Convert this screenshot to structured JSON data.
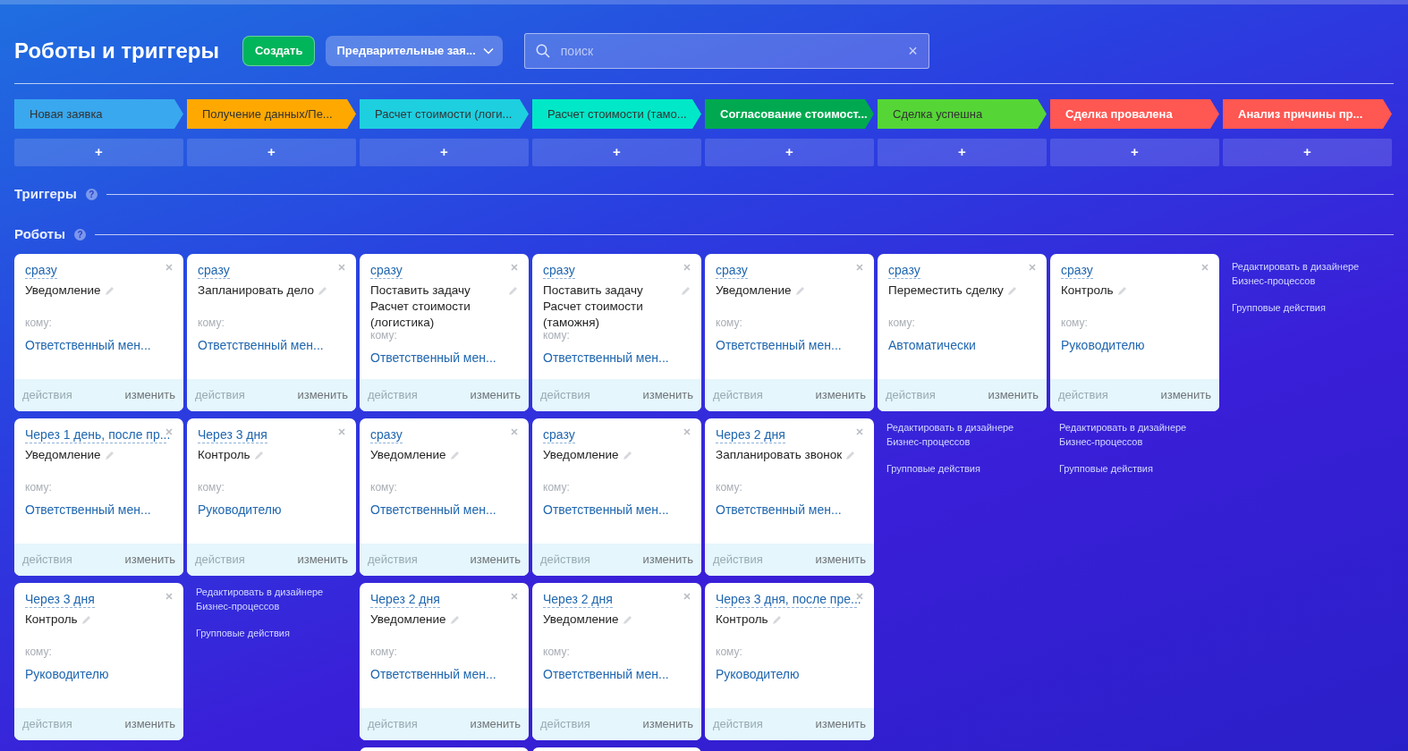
{
  "title": "Роботы и триггеры",
  "create_button": "Создать",
  "category_select": "Предварительные зая...",
  "search": {
    "placeholder": "поиск",
    "clear": "×"
  },
  "add_label": "+",
  "sections": [
    {
      "title": "Триггеры",
      "help": "?"
    },
    {
      "title": "Роботы",
      "help": "?"
    }
  ],
  "stages": [
    {
      "name": "Новая заявка",
      "color": "#39a8ef",
      "robots": [
        {
          "delay": "сразу",
          "action": "Уведомление",
          "to_label": "кому:",
          "recipient": "Ответственный мен...",
          "actions_label": "действия",
          "edit_label": "изменить"
        },
        {
          "delay": "Через 1 день, после пр...",
          "action": "Уведомление",
          "to_label": "кому:",
          "recipient": "Ответственный мен...",
          "actions_label": "действия",
          "edit_label": "изменить"
        },
        {
          "delay": "Через 3 дня",
          "action": "Контроль",
          "to_label": "кому:",
          "recipient": "Руководителю",
          "actions_label": "действия",
          "edit_label": "изменить"
        }
      ]
    },
    {
      "name": "Получение данных/Пе...",
      "color": "#ffa900",
      "robots": [
        {
          "delay": "сразу",
          "action": "Запланировать дело",
          "to_label": "кому:",
          "recipient": "Ответственный мен...",
          "actions_label": "действия",
          "edit_label": "изменить"
        },
        {
          "delay": "Через 3 дня",
          "action": "Контроль",
          "to_label": "кому:",
          "recipient": "Руководителю",
          "actions_label": "действия",
          "edit_label": "изменить"
        }
      ],
      "links": [
        "Редактировать в дизайнере Бизнес-процессов",
        "Групповые действия"
      ]
    },
    {
      "name": "Расчет стоимости (логи...",
      "color": "#1ecfe0",
      "robots": [
        {
          "delay": "сразу",
          "action": "Поставить задачу Расчет стоимости (логистика)",
          "to_label": "кому:",
          "recipient": "Ответственный мен...",
          "actions_label": "действия",
          "edit_label": "изменить"
        },
        {
          "delay": "сразу",
          "action": "Уведомление",
          "to_label": "кому:",
          "recipient": "Ответственный мен...",
          "actions_label": "действия",
          "edit_label": "изменить"
        },
        {
          "delay": "Через 2 дня",
          "action": "Уведомление",
          "to_label": "кому:",
          "recipient": "Ответственный мен...",
          "actions_label": "действия",
          "edit_label": "изменить"
        }
      ],
      "more_below": true
    },
    {
      "name": "Расчет стоимости (тамо...",
      "color": "#00e8c8",
      "robots": [
        {
          "delay": "сразу",
          "action": "Поставить задачу Расчет стоимости (таможня)",
          "to_label": "кому:",
          "recipient": "Ответственный мен...",
          "actions_label": "действия",
          "edit_label": "изменить"
        },
        {
          "delay": "сразу",
          "action": "Уведомление",
          "to_label": "кому:",
          "recipient": "Ответственный мен...",
          "actions_label": "действия",
          "edit_label": "изменить"
        },
        {
          "delay": "Через 2 дня",
          "action": "Уведомление",
          "to_label": "кому:",
          "recipient": "Ответственный мен...",
          "actions_label": "действия",
          "edit_label": "изменить"
        }
      ],
      "more_below": true
    },
    {
      "name": "Согласование стоимост...",
      "color": "#00a94f",
      "robots": [
        {
          "delay": "сразу",
          "action": "Уведомление",
          "to_label": "кому:",
          "recipient": "Ответственный мен...",
          "actions_label": "действия",
          "edit_label": "изменить"
        },
        {
          "delay": "Через 2 дня",
          "action": "Запланировать звонок",
          "to_label": "кому:",
          "recipient": "Ответственный мен...",
          "actions_label": "действия",
          "edit_label": "изменить"
        },
        {
          "delay": "Через 3 дня, после пре...",
          "action": "Контроль",
          "to_label": "кому:",
          "recipient": "Руководителю",
          "actions_label": "действия",
          "edit_label": "изменить"
        }
      ]
    },
    {
      "name": "Сделка успешна",
      "color": "#55d636",
      "robots": [
        {
          "delay": "сразу",
          "action": "Переместить сделку",
          "to_label": "кому:",
          "recipient": "Автоматически",
          "actions_label": "действия",
          "edit_label": "изменить"
        }
      ],
      "links": [
        "Редактировать в дизайнере Бизнес-процессов",
        "Групповые действия"
      ]
    },
    {
      "name": "Сделка провалена",
      "color": "#ff5752",
      "robots": [
        {
          "delay": "сразу",
          "action": "Контроль",
          "to_label": "кому:",
          "recipient": "Руководителю",
          "actions_label": "действия",
          "edit_label": "изменить"
        }
      ],
      "links": [
        "Редактировать в дизайнере Бизнес-процессов",
        "Групповые действия"
      ]
    },
    {
      "name": "Анализ причины пр...",
      "color": "#ff5752",
      "links": [
        "Редактировать в дизайнере Бизнес-процессов",
        "Групповые действия"
      ]
    }
  ]
}
